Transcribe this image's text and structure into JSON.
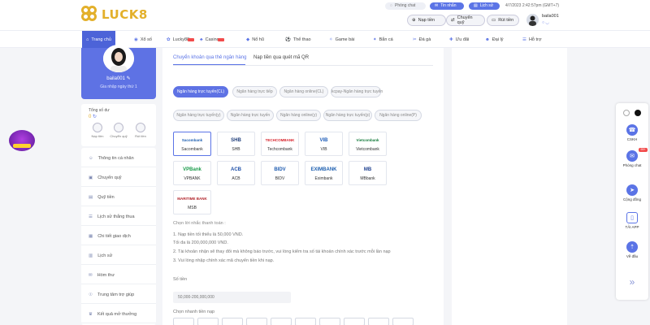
{
  "brand": {
    "logo_text": "LUCK8"
  },
  "topbar": {
    "chat_label": "Phòng chat",
    "messages_label": "Tin nhắn",
    "history_label": "Lịch sử",
    "datetime": "4/7/2023 2:42:57pm  (GMT+7)",
    "deposit_label": "Nạp tiền",
    "transfer_label": "Chuyển quỹ",
    "withdraw_label": "Rút tiền",
    "username": "baila001"
  },
  "nav": [
    {
      "label": "Trang chủ",
      "hot": false
    },
    {
      "label": "Xổ số",
      "hot": false
    },
    {
      "label": "Lucky88",
      "hot": true
    },
    {
      "label": "Casino",
      "hot": true
    },
    {
      "label": "Nổ hũ",
      "hot": false
    },
    {
      "label": "Thể thao",
      "hot": false
    },
    {
      "label": "Game bài",
      "hot": false
    },
    {
      "label": "Bắn cá",
      "hot": false
    },
    {
      "label": "Đá gà",
      "hot": false
    },
    {
      "label": "Ưu đãi",
      "hot": false
    },
    {
      "label": "Đại lý",
      "hot": false
    },
    {
      "label": "Hỗ trợ",
      "hot": false
    }
  ],
  "profile": {
    "name": "baila001",
    "vip": "Gia nhập ngày thứ 1"
  },
  "balance": {
    "label": "Tổng số dư",
    "value": "0",
    "actions": [
      "Nạp tiền",
      "Chuyển quỹ",
      "Rút tiền"
    ]
  },
  "menu": [
    "Thông tin cá nhân",
    "Chuyển quỹ",
    "Quỹ tiền",
    "Lịch sử thắng thua",
    "Chi tiết giao dịch",
    "Lịch sử",
    "Hòm thư",
    "Trung tâm trợ giúp",
    "Kết quả mở thưởng"
  ],
  "tabs": [
    {
      "label": "Chuyển khoản qua thẻ ngân hàng",
      "active": true
    },
    {
      "label": "Nạp tiền qua quét mã QR",
      "active": false
    }
  ],
  "methods": [
    "Ngân hàng trực tuyến(CL)",
    "Ngân hàng trực tiếp",
    "Ngân hàng online(CL)",
    "kcpay-Ngân hàng trực tuyến",
    "Ngân hàng trực tuyến(y)",
    "Ngân hàng trực tuyến",
    "Ngân hàng online(y)",
    "Ngân hàng trực tuyến(p)",
    "Ngân hàng online(P)"
  ],
  "banks": [
    {
      "name": "Sacombank",
      "logo": "Sacombank",
      "color": "#1d5fb0"
    },
    {
      "name": "SHB",
      "logo": "SHB",
      "color": "#1e3d7a"
    },
    {
      "name": "Techcombank",
      "logo": "TECHCOMBANK",
      "color": "#d7212a"
    },
    {
      "name": "VIB",
      "logo": "VIB",
      "color": "#1b5bb8"
    },
    {
      "name": "Vietcombank",
      "logo": "Vietcombank",
      "color": "#137a3b"
    },
    {
      "name": "VPBANK",
      "logo": "VPBank",
      "color": "#1a9b4a"
    },
    {
      "name": "ACB",
      "logo": "ACB",
      "color": "#1d4fa8"
    },
    {
      "name": "BIDV",
      "logo": "BIDV",
      "color": "#1e5bb0"
    },
    {
      "name": "Eximbank",
      "logo": "EXIMBANK",
      "color": "#1d5fb0"
    },
    {
      "name": "MBbank",
      "logo": "MB",
      "color": "#1d3f8f"
    },
    {
      "name": "MSB",
      "logo": "MARITIME BANK",
      "color": "#b0232a"
    }
  ],
  "notes": {
    "title": "Chọn lời nhắc thanh toán :",
    "lines": [
      "1. Nạp tiền tối thiểu là 50,000 VND.",
      "Tối đa là 200,000,000 VND.",
      "2. Tài khoản nhận sẽ thay đổi mà không báo trước, vui lòng kiểm tra số tài khoản chính xác trước mỗi lần nạp",
      "3. Vui lòng nhập chính xác mã chuyển tiền khi nạp."
    ]
  },
  "amount": {
    "label": "Số tiền",
    "placeholder": "50,000-200,000,000",
    "pick_label": "Chọn nhanh tiền nạp"
  },
  "floating": {
    "items": [
      {
        "label": "CSKH",
        "badge": ""
      },
      {
        "label": "Phòng chat",
        "badge": "99+"
      },
      {
        "label": "Cộng đồng",
        "badge": ""
      },
      {
        "label": "TẢI APP",
        "badge": ""
      },
      {
        "label": "Về đầu",
        "badge": ""
      }
    ]
  }
}
